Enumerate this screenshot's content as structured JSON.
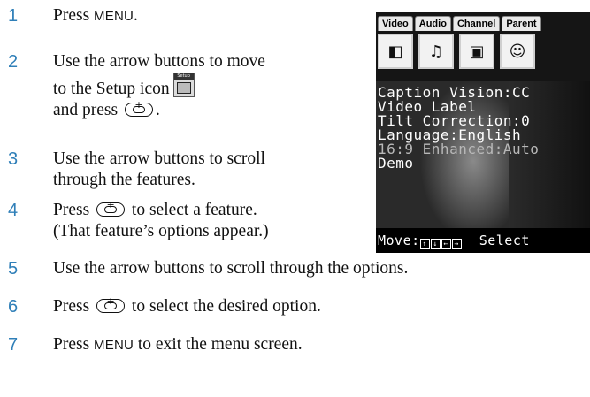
{
  "steps": [
    {
      "num": "1",
      "pre": "Press ",
      "menu": "MENU",
      "post": "."
    },
    {
      "num": "2",
      "line1": "Use the arrow buttons to move",
      "line2a": "to the Setup icon",
      "line3a": "and press ",
      "line3b": "."
    },
    {
      "num": "3",
      "line1": "Use the arrow buttons to scroll",
      "line2": "through the features."
    },
    {
      "num": "4",
      "line1a": "Press ",
      "line1b": " to select a feature.",
      "line2": "(That feature’s options appear.)"
    },
    {
      "num": "5",
      "text": "Use the arrow buttons to scroll through the options."
    },
    {
      "num": "6",
      "pre": "Press ",
      "post": " to select the desired option."
    },
    {
      "num": "7",
      "pre": "Press ",
      "menu": "MENU",
      "post": " to exit the menu screen."
    }
  ],
  "setup_icon": {
    "label": "Setup",
    "icon": "setup-menu-icon"
  },
  "enter_button_icon": "jog-enter-icon",
  "tv": {
    "tabs": [
      "Video",
      "Audio",
      "Channel",
      "Parent"
    ],
    "menu_icons": [
      "video-icon",
      "audio-icon",
      "channel-icon",
      "parent-icon"
    ],
    "menu_icon_glyphs": [
      "◧",
      "♫",
      "▣",
      "☺"
    ],
    "lines": [
      "Caption Vision:CC",
      "Video Label",
      "Tilt Correction:0",
      "Language:English",
      "16:9 Enhanced:Auto",
      "Demo"
    ],
    "footer_move": "Move:",
    "footer_arrows": [
      "↑",
      "↓",
      "←",
      "→"
    ],
    "footer_select": "Select"
  }
}
